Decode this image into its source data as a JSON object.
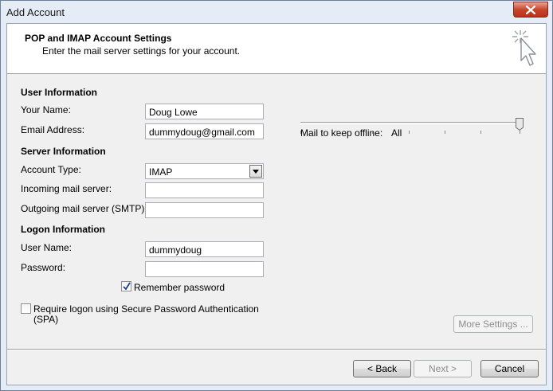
{
  "window": {
    "title": "Add Account"
  },
  "header": {
    "title": "POP and IMAP Account Settings",
    "subtitle": "Enter the mail server settings for your account."
  },
  "user_info": {
    "heading": "User Information",
    "your_name_label": "Your Name:",
    "your_name_value": "Doug Lowe",
    "email_label": "Email Address:",
    "email_value": "dummydoug@gmail.com"
  },
  "server_info": {
    "heading": "Server Information",
    "account_type_label": "Account Type:",
    "account_type_value": "IMAP",
    "incoming_label": "Incoming mail server:",
    "incoming_value": "",
    "outgoing_label": "Outgoing mail server (SMTP):",
    "outgoing_value": ""
  },
  "logon_info": {
    "heading": "Logon Information",
    "username_label": "User Name:",
    "username_value": "dummydoug",
    "password_label": "Password:",
    "password_value": "",
    "remember_label": "Remember password",
    "remember_checked": true,
    "spa_label_line1": "Require logon using Secure Password Authentication",
    "spa_label_line2": "(SPA)",
    "spa_checked": false
  },
  "offline": {
    "label": "Mail to keep offline:",
    "value": "All",
    "slider_level": 1.0
  },
  "buttons": {
    "more_settings": "More Settings ...",
    "back": "< Back",
    "next": "Next >",
    "cancel": "Cancel"
  }
}
